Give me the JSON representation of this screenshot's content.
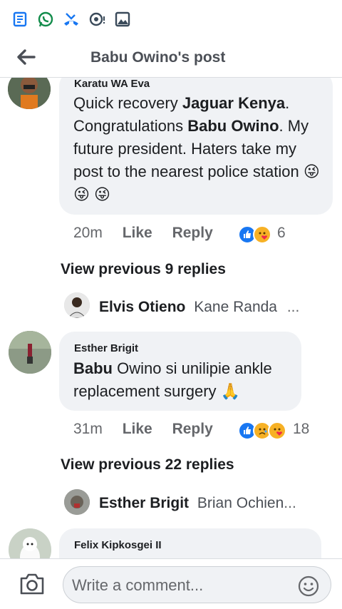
{
  "header": {
    "title": "Babu Owino's post"
  },
  "comments": [
    {
      "author": "Karatu WA Eva",
      "text_parts": [
        "Quick recovery ",
        "Jaguar Kenya",
        ". Congratulations ",
        "Babu Owino",
        ". My future president. Haters take my post to the nearest police station "
      ],
      "emojis": "😜 😜 😜",
      "time": "20m",
      "like": "Like",
      "reply": "Reply",
      "reaction_count": "6",
      "view_previous": "View previous 9 replies",
      "latest_reply": {
        "author": "Elvis Otieno",
        "text": "Kane Randa",
        "more": "..."
      }
    },
    {
      "author": "Esther Brigit",
      "text_parts": [
        "Babu",
        " Owino si unilipie ankle replacement surgery "
      ],
      "emojis": "🙏",
      "time": "31m",
      "like": "Like",
      "reply": "Reply",
      "reaction_count": "18",
      "view_previous": "View previous 22 replies",
      "latest_reply": {
        "author": "Esther Brigit",
        "text": "Brian Ochien",
        "more": "..."
      }
    },
    {
      "author": "Felix Kipkosgei II"
    }
  ],
  "composer": {
    "placeholder": "Write a comment..."
  },
  "colors": {
    "like_blue": "#1877f2",
    "haha_yellow": "#f7b125",
    "sad_yellow": "#f7b125",
    "text_gray": "#65676b"
  },
  "icons": [
    "news-icon",
    "whatsapp-icon",
    "missed-call-icon",
    "chat-bubble-icon",
    "gallery-icon",
    "back-arrow-icon",
    "camera-icon",
    "emoji-icon"
  ]
}
